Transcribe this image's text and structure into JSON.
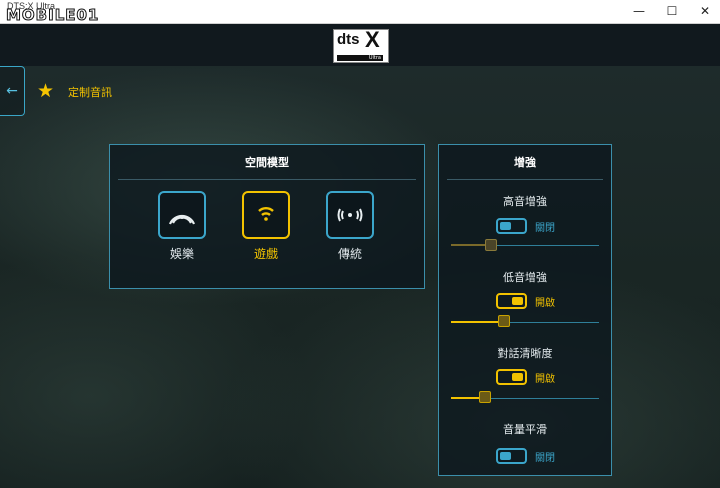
{
  "window": {
    "app_title": "DTS:X Ultra",
    "watermark": "MOBILE01",
    "minimize": "—",
    "maximize": "☐",
    "close": "✕"
  },
  "header": {
    "logo_main": "dts",
    "logo_x": "X",
    "logo_sub": "Ultra"
  },
  "nav": {
    "back_icon": "←",
    "star_icon": "★",
    "breadcrumb": "定制音訊"
  },
  "spatial": {
    "title": "空間模型",
    "modes": [
      {
        "label": "娛樂",
        "icon": "headphone-icon",
        "active": false
      },
      {
        "label": "遊戲",
        "icon": "wifi-icon",
        "active": true
      },
      {
        "label": "傳統",
        "icon": "stereo-icon",
        "active": false
      }
    ]
  },
  "enhance": {
    "title": "增強",
    "features": [
      {
        "label": "高音增強",
        "toggle": "關閉",
        "on": false,
        "level": 0.27
      },
      {
        "label": "低音增強",
        "toggle": "開啟",
        "on": true,
        "level": 0.36
      },
      {
        "label": "對話清晰度",
        "toggle": "開啟",
        "on": true,
        "level": 0.23
      },
      {
        "label": "音量平滑",
        "toggle": "關閉",
        "on": false
      }
    ]
  },
  "colors": {
    "accent_blue": "#3ba6cb",
    "accent_yellow": "#f2c200",
    "panel_border": "#3b8fab"
  }
}
